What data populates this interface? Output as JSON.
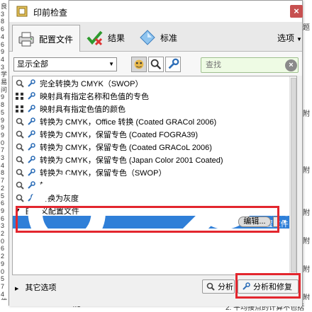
{
  "background": {
    "left_text": [
      "良",
      "3",
      "8",
      "6",
      "4",
      "6",
      "9",
      "4",
      "3",
      "学",
      "易",
      "问",
      "9",
      "8",
      "5",
      "9",
      "9",
      "9",
      "0",
      "7",
      "3",
      "4",
      "8",
      "7",
      "2",
      "5",
      "6",
      "9",
      "6",
      "3",
      "2",
      "0",
      "6",
      "2",
      "9",
      "0",
      "5",
      "7",
      "4",
      "优"
    ],
    "right_text": [
      "题",
      "附",
      "附",
      "附",
      "附",
      "附",
      "附"
    ],
    "bottom_text": "4.3",
    "bottom_right_text": "2. 平均接点的计算不包括"
  },
  "window": {
    "title": "印前检查",
    "close_icon": "×"
  },
  "tabs": [
    {
      "label": "配置文件",
      "icon": "printer-icon",
      "active": true
    },
    {
      "label": "结果",
      "icon": "checkmark-wrench-icon",
      "active": false
    },
    {
      "label": "标准",
      "icon": "diamond-icon",
      "active": false
    }
  ],
  "options_label": "选项",
  "toolbar": {
    "filter_value": "显示全部",
    "search_placeholder": "查找"
  },
  "profiles": [
    {
      "label": "完全转换为 CMYK（SWOP）",
      "icon": "magnifier-icon"
    },
    {
      "label": "映射具有指定名称和色值的专色",
      "icon": "dots-icon"
    },
    {
      "label": "映射具有指定色值的颜色",
      "icon": "dots-icon"
    },
    {
      "label": "转换为 CMYK，Office 转换 (Coated GRACol 2006)",
      "icon": "magnifier-icon"
    },
    {
      "label": "转换为 CMYK，保留专色 (Coated FOGRA39)",
      "icon": "magnifier-icon"
    },
    {
      "label": "转换为 CMYK，保留专色 (Coated GRACoL 2006)",
      "icon": "magnifier-icon"
    },
    {
      "label": "转换为 CMYK，保留专色 (Japan Color 2001 Coated)",
      "icon": "magnifier-icon"
    },
    {
      "label": "转换为 CMYK，保留专色（SWOP）",
      "icon": "magnifier-icon"
    },
    {
      "label": "转换为 sRGB",
      "icon": "magnifier-icon"
    },
    {
      "label": "转换为灰度",
      "icon": "magnifier-icon"
    }
  ],
  "custom_section_label": "自定义配置文件",
  "selected_profile": {
    "label": "新建配置文件 1",
    "edit_label": "编辑..."
  },
  "bottom": {
    "other_options_label": "其它选项",
    "analyze_label": "分析",
    "analyze_fix_label": "分析和修复"
  },
  "colors": {
    "selection": "#2f7fd8",
    "highlight_box": "#e3262e",
    "close_button": "#c75050",
    "search_bg": "#eefbe4"
  }
}
